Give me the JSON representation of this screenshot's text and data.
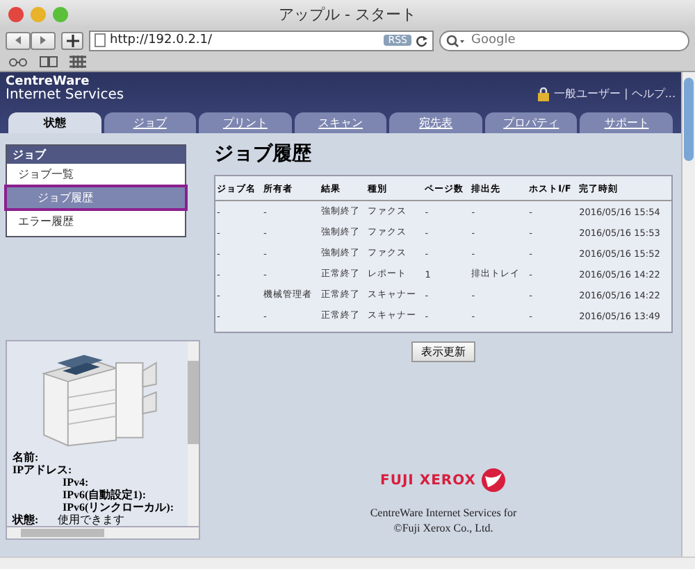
{
  "window": {
    "title": "アップル - スタート"
  },
  "toolbar": {
    "url": "http://192.0.2.1/",
    "rss": "RSS",
    "search_placeholder": "Google"
  },
  "header": {
    "brand_line1": "CentreWare",
    "brand_line2": "Internet Services",
    "user": "一般ユーザー | ヘルプ..."
  },
  "tabs": [
    {
      "label": "状態",
      "selected": true
    },
    {
      "label": "ジョブ",
      "selected": false
    },
    {
      "label": "プリント",
      "selected": false
    },
    {
      "label": "スキャン",
      "selected": false
    },
    {
      "label": "宛先表",
      "selected": false
    },
    {
      "label": "プロパティ",
      "selected": false
    },
    {
      "label": "サポート",
      "selected": false
    }
  ],
  "sidebar": {
    "heading": "ジョブ",
    "items": [
      {
        "label": "ジョブ一覧",
        "selected": false
      },
      {
        "label": "ジョブ履歴",
        "selected": true
      },
      {
        "label": "エラー履歴",
        "selected": false
      }
    ]
  },
  "device": {
    "rows": [
      {
        "label": "名前:"
      },
      {
        "label": "IPアドレス:",
        "children": [
          {
            "label": "IPv4:"
          },
          {
            "label": "IPv6(自動設定1):"
          },
          {
            "label": "IPv6(リンクローカル):"
          }
        ]
      }
    ],
    "status_label": "状態:",
    "status_value": "使用できます"
  },
  "main": {
    "title": "ジョブ履歴",
    "columns": [
      "ジョブ名",
      "所有者",
      "結果",
      "種別",
      "ページ数",
      "排出先",
      "ホストI/F",
      "完了時刻"
    ],
    "rows": [
      [
        "-",
        "-",
        "強制終了",
        "ファクス",
        "-",
        "-",
        "-",
        "2016/05/16 15:54"
      ],
      [
        "-",
        "-",
        "強制終了",
        "ファクス",
        "-",
        "-",
        "-",
        "2016/05/16 15:53"
      ],
      [
        "-",
        "-",
        "強制終了",
        "ファクス",
        "-",
        "-",
        "-",
        "2016/05/16 15:52"
      ],
      [
        "-",
        "-",
        "正常終了",
        "レポート",
        "1",
        "排出トレイ",
        "-",
        "2016/05/16 14:22"
      ],
      [
        "-",
        "機械管理者",
        "正常終了",
        "スキャナー",
        "-",
        "-",
        "-",
        "2016/05/16 14:22"
      ],
      [
        "-",
        "-",
        "正常終了",
        "スキャナー",
        "-",
        "-",
        "-",
        "2016/05/16 13:49"
      ]
    ],
    "refresh_button": "表示更新"
  },
  "footer": {
    "logo": "FUJI XEROX",
    "line1": "CentreWare Internet Services for",
    "line2": "©Fuji Xerox Co., Ltd."
  }
}
